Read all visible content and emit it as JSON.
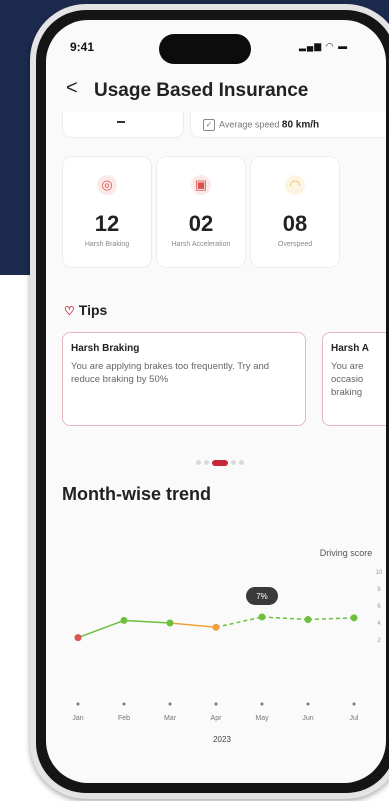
{
  "status": {
    "time": "9:41"
  },
  "header": {
    "back": "<",
    "title": "Usage Based Insurance"
  },
  "summary": {
    "avg_speed_label": "Average speed",
    "avg_speed_value": "80 km/h"
  },
  "stats": [
    {
      "value": "12",
      "label": "Harsh Braking",
      "icon": "brake-icon",
      "color": "#d9534f"
    },
    {
      "value": "02",
      "label": "Harsh Acceleration",
      "icon": "accelerator-icon",
      "color": "#d9534f"
    },
    {
      "value": "08",
      "label": "Overspeed",
      "icon": "speedometer-icon",
      "color": "#e8b84b"
    }
  ],
  "tips": {
    "heading": "Tips",
    "cards": [
      {
        "title": "Harsh Braking",
        "body": "You are applying brakes too frequently. Try and reduce braking by 50%"
      },
      {
        "title": "Harsh A",
        "body": "You are occasio braking"
      }
    ]
  },
  "trend": {
    "title": "Month-wise trend"
  },
  "chart_data": {
    "type": "line",
    "title": "Month-wise trend",
    "ylabel": "Driving score",
    "xlabel": "2023",
    "categories": [
      "Jan",
      "Feb",
      "Mar",
      "Apr",
      "May",
      "Jun",
      "Jul"
    ],
    "values": [
      4,
      6,
      5.7,
      5.2,
      6.4,
      6.1,
      6.3
    ],
    "point_colors": [
      "#d9534f",
      "#6dbf3c",
      "#6dbf3c",
      "#f0a23a",
      "#6dbf3c",
      "#6dbf3c",
      "#6dbf3c"
    ],
    "yticks": [
      "10",
      "8",
      "6",
      "4",
      "2"
    ],
    "ylim": [
      0,
      10
    ],
    "tooltip": "7%",
    "tooltip_index": 4
  }
}
